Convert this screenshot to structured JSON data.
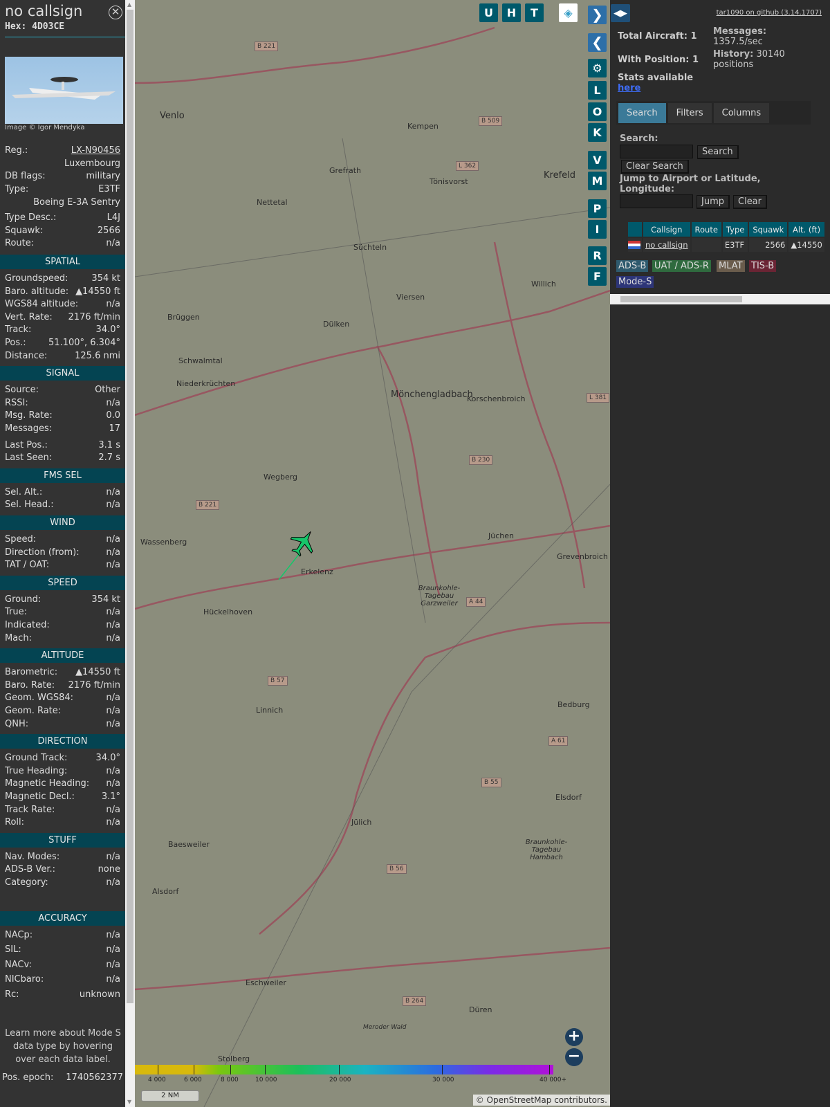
{
  "selected": {
    "callsign": "no callsign",
    "hex_label": "Hex:",
    "hex": "4D03CE",
    "photo_credit": "Image © Igor Mendyka",
    "info": [
      {
        "label": "Reg.:",
        "value": "LX-N90456"
      },
      {
        "label": "",
        "value": "Luxembourg"
      },
      {
        "label": "DB flags:",
        "value": "military"
      },
      {
        "label": "Type:",
        "value": "E3TF"
      },
      {
        "label": "",
        "value": "Boeing E-3A Sentry"
      },
      {
        "label": "Type Desc.:",
        "value": "L4J"
      },
      {
        "label": "Squawk:",
        "value": "2566"
      },
      {
        "label": "Route:",
        "value": "n/a"
      }
    ],
    "sections": [
      {
        "title": "SPATIAL",
        "rows": [
          {
            "label": "Groundspeed:",
            "value": "354 kt"
          },
          {
            "label": "Baro. altitude:",
            "value": "▲14550 ft"
          },
          {
            "label": "WGS84 altitude:",
            "value": "n/a"
          },
          {
            "label": "Vert. Rate:",
            "value": "2176 ft/min"
          },
          {
            "label": "Track:",
            "value": "34.0°"
          },
          {
            "label": "Pos.:",
            "value": "51.100°, 6.304°"
          },
          {
            "label": "Distance:",
            "value": "125.6 nmi"
          }
        ]
      },
      {
        "title": "SIGNAL",
        "rows": [
          {
            "label": "Source:",
            "value": "Other"
          },
          {
            "label": "RSSI:",
            "value": "n/a"
          },
          {
            "label": "Msg. Rate:",
            "value": "0.0"
          },
          {
            "label": "Messages:",
            "value": "17"
          },
          {
            "label": "Last Pos.:",
            "value": "3.1 s"
          },
          {
            "label": "Last Seen:",
            "value": "2.7 s"
          }
        ]
      },
      {
        "title": "FMS SEL",
        "rows": [
          {
            "label": "Sel. Alt.:",
            "value": "n/a"
          },
          {
            "label": "Sel. Head.:",
            "value": "n/a"
          }
        ]
      },
      {
        "title": "WIND",
        "rows": [
          {
            "label": "Speed:",
            "value": "n/a"
          },
          {
            "label": "Direction (from):",
            "value": "n/a"
          },
          {
            "label": "TAT / OAT:",
            "value": "n/a"
          }
        ]
      },
      {
        "title": "SPEED",
        "rows": [
          {
            "label": "Ground:",
            "value": "354 kt"
          },
          {
            "label": "True:",
            "value": "n/a"
          },
          {
            "label": "Indicated:",
            "value": "n/a"
          },
          {
            "label": "Mach:",
            "value": "n/a"
          }
        ]
      },
      {
        "title": "ALTITUDE",
        "rows": [
          {
            "label": "Barometric:",
            "value": "▲14550 ft"
          },
          {
            "label": "Baro. Rate:",
            "value": "2176 ft/min"
          },
          {
            "label": "Geom. WGS84:",
            "value": "n/a"
          },
          {
            "label": "Geom. Rate:",
            "value": "n/a"
          },
          {
            "label": "QNH:",
            "value": "n/a"
          }
        ]
      },
      {
        "title": "DIRECTION",
        "rows": [
          {
            "label": "Ground Track:",
            "value": "34.0°"
          },
          {
            "label": "True Heading:",
            "value": "n/a"
          },
          {
            "label": "Magnetic Heading:",
            "value": "n/a"
          },
          {
            "label": "Magnetic Decl.:",
            "value": "3.1°"
          },
          {
            "label": "Track Rate:",
            "value": "n/a"
          },
          {
            "label": "Roll:",
            "value": "n/a"
          }
        ]
      },
      {
        "title": "STUFF",
        "rows": [
          {
            "label": "Nav. Modes:",
            "value": "n/a"
          },
          {
            "label": "ADS-B Ver.:",
            "value": "none"
          },
          {
            "label": "Category:",
            "value": "n/a"
          }
        ]
      },
      {
        "title": "ACCURACY",
        "rows": [
          {
            "label": "NACp:",
            "value": "n/a"
          },
          {
            "label": "SIL:",
            "value": "n/a"
          },
          {
            "label": "NACv:",
            "value": "n/a"
          },
          {
            "label": "NICbaro:",
            "value": "n/a"
          },
          {
            "label": "Rc:",
            "value": "unknown"
          }
        ]
      }
    ],
    "note": "Learn more about Mode S data type by hovering over each data label.",
    "pos_epoch_label": "Pos. epoch:",
    "pos_epoch": "1740562377"
  },
  "map": {
    "buttons_top": [
      "U",
      "H",
      "T"
    ],
    "buttons_side": [
      "L",
      "O",
      "K",
      "V",
      "M",
      "P",
      "I",
      "R",
      "F"
    ],
    "places": [
      "Venlo",
      "Kempen",
      "Krefeld",
      "Nettetal",
      "Grefrath",
      "Tönisvorst",
      "Süchteln",
      "Viersen",
      "Dülken",
      "Willich",
      "Brüggen",
      "Schwalmtal",
      "Niederkrüchten",
      "Mönchengladbach",
      "Korschenbroich",
      "Wegberg",
      "Wassenberg",
      "Erkelenz",
      "Jüchen",
      "Grevenbroich",
      "Hückelhoven",
      "Braunkohle-Tagebau Garzweiler",
      "Linnich",
      "Bedburg",
      "Jülich",
      "Elsdorf",
      "Baesweiler",
      "Braunkohle-Tagebau Hambach",
      "Alsdorf",
      "Eschweiler",
      "Düren",
      "Stolberg",
      "Meroder Wald"
    ],
    "roads": [
      "B 221",
      "B 509",
      "L 362",
      "B 230",
      "L 381",
      "B 221",
      "A 44",
      "B 57",
      "A 61",
      "B 55",
      "B 56",
      "B 264"
    ],
    "altitude_scale": [
      "4 000",
      "6 000",
      "8 000",
      "10 000",
      "20 000",
      "30 000",
      "40 000+"
    ],
    "scale_label": "2 NM",
    "attribution": "© OpenStreetMap contributors."
  },
  "right": {
    "github": "tar1090 on github (3.14.1707)",
    "total_aircraft": "Total Aircraft: 1",
    "with_position": "With Position: 1",
    "stats_text": "Stats available",
    "stats_link": "here",
    "messages_label": "Messages:",
    "messages": "1357.5/sec",
    "history_label": "History:",
    "history": "30140 positions",
    "tabs": [
      "Search",
      "Filters",
      "Columns"
    ],
    "search_label": "Search:",
    "search_button": "Search",
    "clear_search": "Clear Search",
    "jump_label": "Jump to Airport or Latitude, Longitude:",
    "jump_button": "Jump",
    "clear_button": "Clear",
    "columns": [
      "",
      "Callsign",
      "Route",
      "Type",
      "Squawk",
      "Alt. (ft)"
    ],
    "rows": [
      {
        "callsign": "no callsign",
        "route": "",
        "type": "E3TF",
        "squawk": "2566",
        "alt": "▲14550"
      }
    ],
    "legend": [
      "ADS-B",
      "UAT / ADS-R",
      "MLAT",
      "TIS-B",
      "Mode-S"
    ]
  }
}
